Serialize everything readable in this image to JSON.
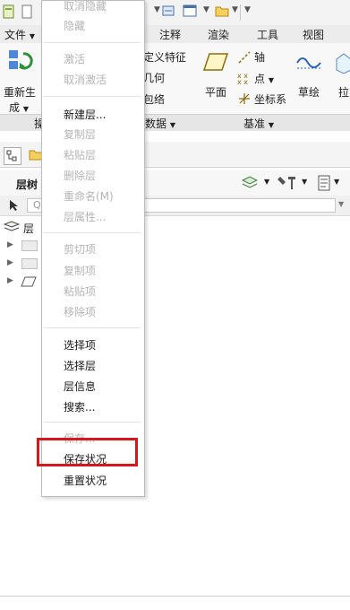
{
  "tabs": {
    "file": "文件",
    "annotate": "注释",
    "render": "渲染",
    "tools": "工具",
    "view": "视图"
  },
  "ribbon": {
    "regenerate_line1": "重新生",
    "regenerate_line2": "成",
    "user_defined_feature": "定义特征",
    "copy_geometry": "几何",
    "shrinkwrap": "包络",
    "plane": "平面",
    "axis": "轴",
    "point": "点",
    "coordinate_system": "坐标系",
    "sketch": "草绘",
    "extrude_partial": "拉",
    "group_operations_partial": "操",
    "group_data_partial": "数据",
    "group_datum": "基准"
  },
  "panel": {
    "layer_tree_tab": "层树",
    "layers_root": "层",
    "search_placeholder": "Q"
  },
  "context_menu": {
    "items": [
      {
        "label": "取消隐藏",
        "enabled": false
      },
      {
        "label": "隐藏",
        "enabled": false
      },
      {
        "label": "激活",
        "enabled": false
      },
      {
        "label": "取消激活",
        "enabled": false
      },
      {
        "label": "新建层...",
        "enabled": true
      },
      {
        "label": "复制层",
        "enabled": false
      },
      {
        "label": "粘贴层",
        "enabled": false
      },
      {
        "label": "删除层",
        "enabled": false
      },
      {
        "label": "重命名(M)",
        "enabled": false
      },
      {
        "label": "层属性...",
        "enabled": false
      },
      {
        "label": "剪切项",
        "enabled": false
      },
      {
        "label": "复制项",
        "enabled": false
      },
      {
        "label": "粘贴项",
        "enabled": false
      },
      {
        "label": "移除项",
        "enabled": false
      },
      {
        "label": "选择项",
        "enabled": true
      },
      {
        "label": "选择层",
        "enabled": true
      },
      {
        "label": "层信息",
        "enabled": true
      },
      {
        "label": "搜索...",
        "enabled": true
      },
      {
        "label": "保存...",
        "enabled": false
      },
      {
        "label": "保存状况",
        "enabled": true
      },
      {
        "label": "重置状况",
        "enabled": true
      }
    ]
  },
  "colors": {
    "highlight": "#d2191e",
    "disabled_text": "#b4b4b4",
    "menu_bg": "#ffffff"
  }
}
